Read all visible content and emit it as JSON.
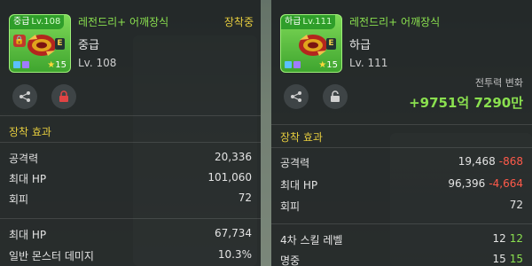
{
  "left": {
    "grade_tag": "중급",
    "grade_tag_level": "Lv.108",
    "item_name": "레전드리+ 어깨장식",
    "grade": "중급",
    "level": "Lv. 108",
    "status": "장착중",
    "star_count": "15",
    "badge_letter": "E",
    "section_title": "장착 효과",
    "stats": [
      {
        "label": "공격력",
        "value": "20,336"
      },
      {
        "label": "최대 HP",
        "value": "101,060"
      },
      {
        "label": "회피",
        "value": "72"
      }
    ],
    "extra_stats": [
      {
        "label": "최대 HP",
        "value": "67,734"
      },
      {
        "label": "일반 몬스터 데미지",
        "value": "10.3%"
      }
    ]
  },
  "right": {
    "grade_tag": "하급",
    "grade_tag_level": "Lv.111",
    "item_name": "레전드리+ 어깨장식",
    "grade": "하급",
    "level": "Lv. 111",
    "star_count": "15",
    "badge_letter": "E",
    "cp_label": "전투력 변화",
    "cp_value": "+9751억 7290만",
    "section_title": "장착 효과",
    "stats": [
      {
        "label": "공격력",
        "value": "19,468",
        "diff": "-868"
      },
      {
        "label": "최대 HP",
        "value": "96,396",
        "diff": "-4,664"
      },
      {
        "label": "회피",
        "value": "72",
        "diff": ""
      }
    ],
    "extra_stats": [
      {
        "label": "4차 스킬 레벨",
        "value": "12",
        "diff": "12"
      },
      {
        "label": "명중",
        "value": "15",
        "diff": "15"
      }
    ]
  },
  "colors": {
    "accent_green": "#8ae04f",
    "status_yellow": "#e5cc3e",
    "negative_red": "#ff5a4a"
  },
  "icons": [
    "share-icon",
    "lock-icon",
    "unlock-icon",
    "star-icon",
    "shoulder-ornament-icon"
  ]
}
